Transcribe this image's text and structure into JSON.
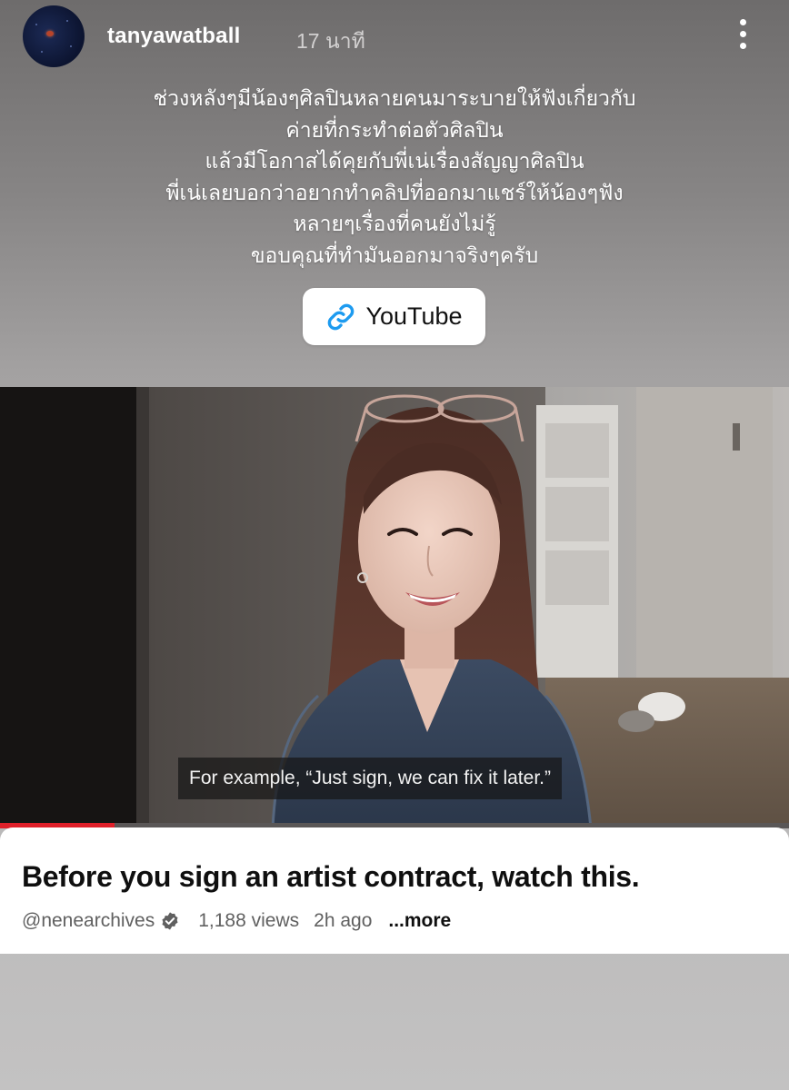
{
  "post": {
    "username": "tanyawatball",
    "timestamp": "17 นาที"
  },
  "caption": {
    "lines": [
      "ช่วงหลังๆมีน้องๆศิลปินหลายคนมาระบายให้ฟังเกี่ยวกับ",
      "ค่ายที่กระทำต่อตัวศิลปิน",
      "แล้วมีโอกาสได้คุยกับพี่เน่เรื่องสัญญาศิลปิน",
      "พี่เน่เลยบอกว่าอยากทำคลิปที่ออกมาแชร์ให้น้องๆฟัง",
      "หลายๆเรื่องที่คนยังไม่รู้",
      "ขอบคุณที่ทำมันออกมาจริงๆครับ"
    ]
  },
  "link_sticker": {
    "label": "YouTube",
    "icon": "link-icon",
    "icon_color": "#1d9bf0"
  },
  "video": {
    "subtitle": "For example, “Just sign, we can fix it later.”",
    "progress_fraction": 0.145,
    "progress_color": "#e0202a",
    "title": "Before you sign an artist contract, watch this.",
    "channel": "@nenearchives",
    "verified_icon": "verified-badge-icon",
    "views": "1,188 views",
    "age": "2h ago",
    "more": "...more"
  }
}
